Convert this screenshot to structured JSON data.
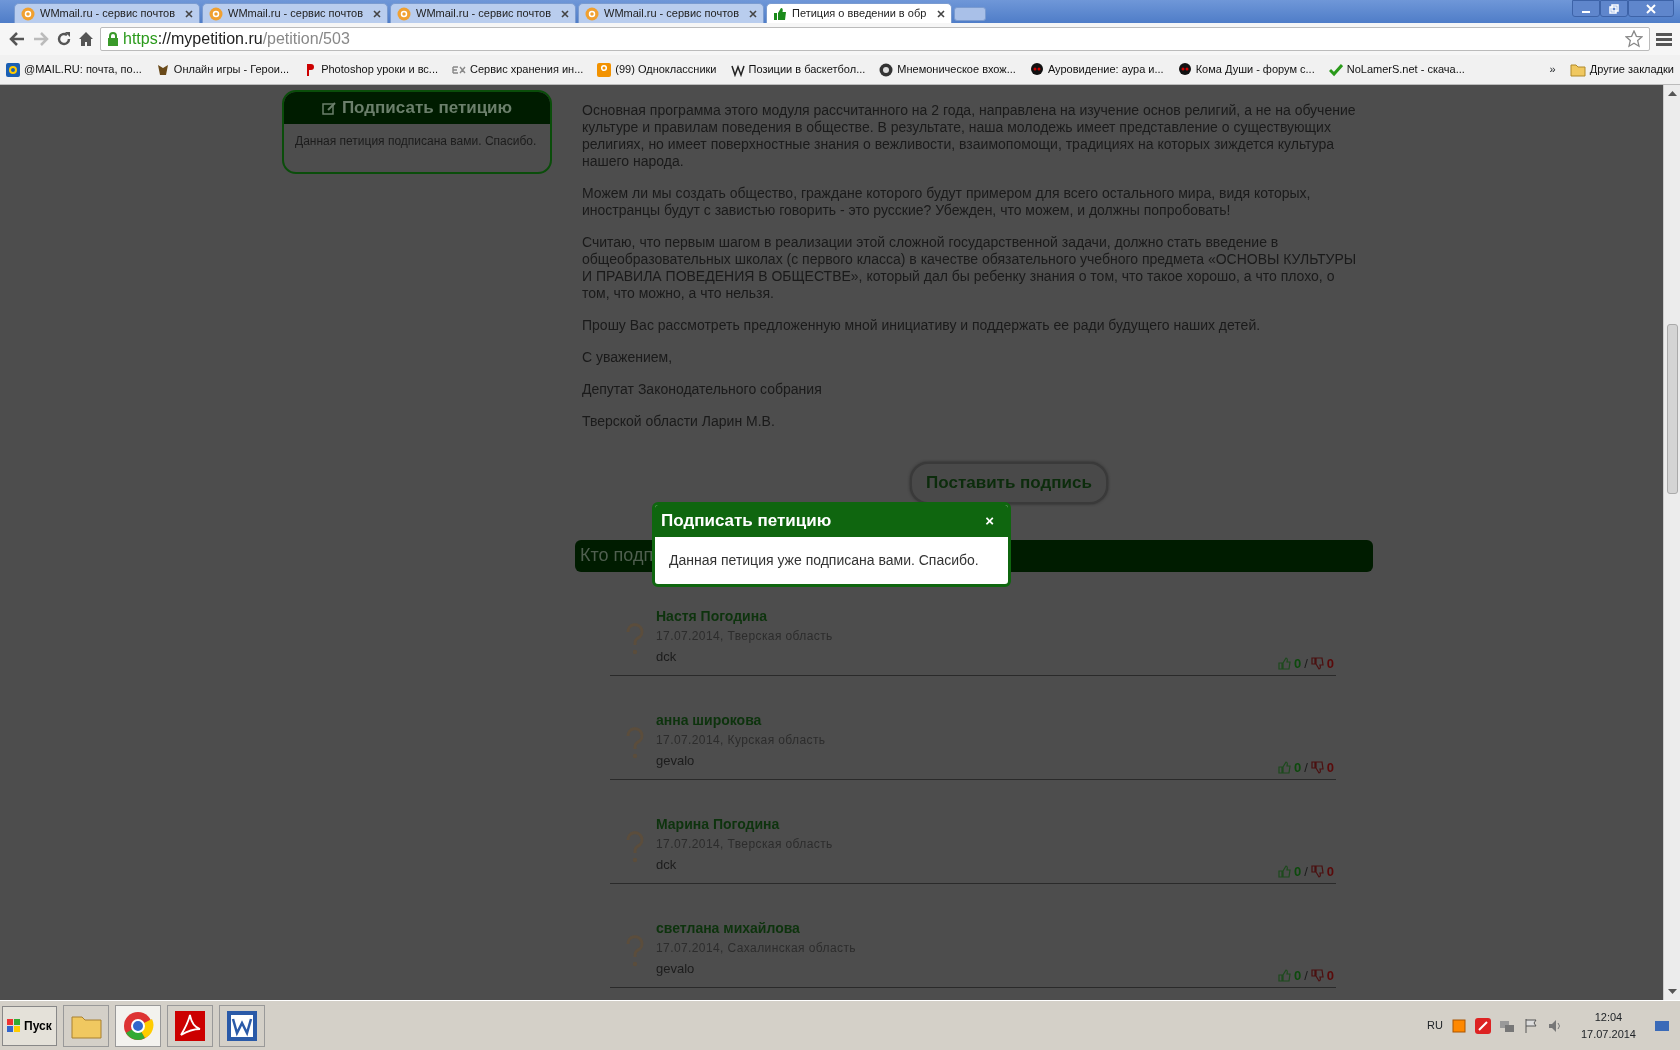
{
  "browser": {
    "tabs": [
      {
        "title": "WMmail.ru - сервис почтов",
        "selected": false
      },
      {
        "title": "WMmail.ru - сервис почтов",
        "selected": false
      },
      {
        "title": "WMmail.ru - сервис почтов",
        "selected": false
      },
      {
        "title": "WMmail.ru - сервис почтов",
        "selected": false
      },
      {
        "title": "Петиция о введении в обр",
        "selected": true
      }
    ],
    "url": [
      {
        "kind": "scheme",
        "text": "https"
      },
      {
        "kind": "host",
        "text": "://mypetition.ru"
      },
      {
        "kind": "path",
        "text": "/petition/503"
      }
    ],
    "bookmarks": [
      "@MAIL.RU: почта, по...",
      "Онлайн игры - Герои...",
      "Photoshop уроки и вс...",
      "Сервис хранения ин...",
      "(99) Одноклассники",
      "Позиции в баскетбол...",
      "Мнемоническое вхож...",
      "Аурoвидение: аура и...",
      "Кома Души - форум с...",
      "NoLamerS.net - скача..."
    ],
    "bookmarks_overflow": "»",
    "other_bookmarks": "Другие закладки"
  },
  "sidebar_card": {
    "title": "Подписать петицию",
    "text": "Данная петиция подписана вами. Спасибо."
  },
  "petition_text": [
    "Основная программа этого модуля рассчитанного на 2 года, направлена на изучение основ религий, а не на обучение культуре и правилам поведения в обществе. В результате, наша молодежь имеет представление о существующих религиях, но имеет поверхностные знания о вежливости, взаимопомощи, традициях на которых зиждется культура нашего народа.",
    "Можем ли мы создать общество, граждане которого будут примером для всего остального мира, видя которых, иностранцы будут с завистью говорить - это русские? Убежден, что можем, и должны попробовать!",
    "Считаю, что первым шагом в реализации этой сложной государственной задачи, должно стать введение в общеобразовательных школах (с первого класса) в качестве обязательного учебного предмета «ОСНОВЫ КУЛЬТУРЫ И ПРАВИЛА ПОВЕДЕНИЯ В ОБЩЕСТВЕ», который дал бы ребенку знания о том, что такое хорошо, а что плохо, о том, что можно, а что нельзя.",
    "Прошу Вас рассмотреть предложенную мной инициативу и поддержать ее ради будущего наших детей.",
    "С уважением,",
    "Депутат Законодательного собрания",
    "Тверской области Ларин М.В."
  ],
  "sign_button": "Поставить подпись",
  "signers": {
    "title": "Кто подп",
    "items": [
      {
        "name": "Настя Погодина",
        "meta": "17.07.2014, Тверская область",
        "comment": "dck",
        "likes": "0",
        "separator": "/",
        "dislikes": "0"
      },
      {
        "name": "анна широкова",
        "meta": "17.07.2014, Курская область",
        "comment": "gevalo",
        "likes": "0",
        "separator": "/",
        "dislikes": "0"
      },
      {
        "name": "Марина Погодина",
        "meta": "17.07.2014, Тверская область",
        "comment": "dck",
        "likes": "0",
        "separator": "/",
        "dislikes": "0"
      },
      {
        "name": "светлана михайлова",
        "meta": "17.07.2014, Сахалинская область",
        "comment": "gevalo",
        "likes": "0",
        "separator": "/",
        "dislikes": "0"
      }
    ]
  },
  "modal": {
    "title": "Подписать петицию",
    "close": "×",
    "message": "Данная петиция уже подписана вами. Спасибо."
  },
  "taskbar": {
    "start": "Пуск",
    "language": "RU",
    "time": "12:04",
    "date": "17.07.2014"
  }
}
